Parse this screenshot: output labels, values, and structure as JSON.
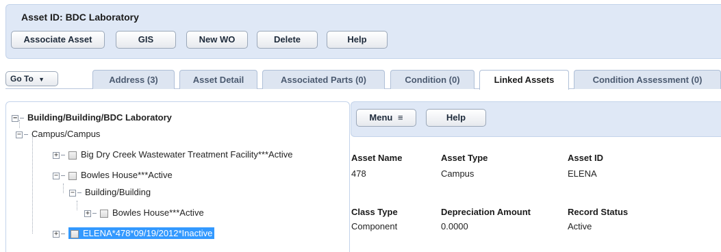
{
  "header": {
    "title": "Asset ID: BDC Laboratory",
    "buttons": [
      "Associate Asset",
      "GIS",
      "New WO",
      "Delete",
      "Help"
    ]
  },
  "goto": {
    "label": "Go To",
    "icon": "chevron-down-icon"
  },
  "tabs": [
    {
      "label": "Address (3)",
      "active": false
    },
    {
      "label": "Asset Detail",
      "active": false
    },
    {
      "label": "Associated Parts (0)",
      "active": false
    },
    {
      "label": "Condition (0)",
      "active": false
    },
    {
      "label": "Linked Assets",
      "active": true
    },
    {
      "label": "Condition Assessment (0)",
      "active": false
    }
  ],
  "tree": {
    "nodes": [
      {
        "label": "Building/Building/BDC Laboratory",
        "expander": "−",
        "checkbox": false,
        "selected": false
      },
      {
        "label": "Campus/Campus",
        "expander": "−",
        "checkbox": false,
        "selected": false
      },
      {
        "label": "Big Dry Creek Wastewater Treatment Facility***Active",
        "expander": "+",
        "checkbox": true,
        "selected": false
      },
      {
        "label": "Bowles House***Active",
        "expander": "−",
        "checkbox": true,
        "selected": false
      },
      {
        "label": "Building/Building",
        "expander": "−",
        "checkbox": false,
        "selected": false
      },
      {
        "label": "Bowles House***Active",
        "expander": "+",
        "checkbox": true,
        "selected": false
      },
      {
        "label": "ELENA*478*09/19/2012*Inactive",
        "expander": "+",
        "checkbox": true,
        "selected": true
      }
    ]
  },
  "detail": {
    "menu_label": "Menu",
    "help_label": "Help",
    "fields": [
      {
        "label": "Asset Name",
        "value": "478"
      },
      {
        "label": "Asset Type",
        "value": "Campus"
      },
      {
        "label": "Asset ID",
        "value": "ELENA"
      },
      {
        "label": "Class Type",
        "value": "Component"
      },
      {
        "label": "Depreciation Amount",
        "value": "0.0000"
      },
      {
        "label": "Record Status",
        "value": "Active"
      }
    ]
  },
  "colors": {
    "panel_bg": "#dfe8f6",
    "selected_bg": "#3399ff",
    "tab_bg": "#dde5f1"
  }
}
